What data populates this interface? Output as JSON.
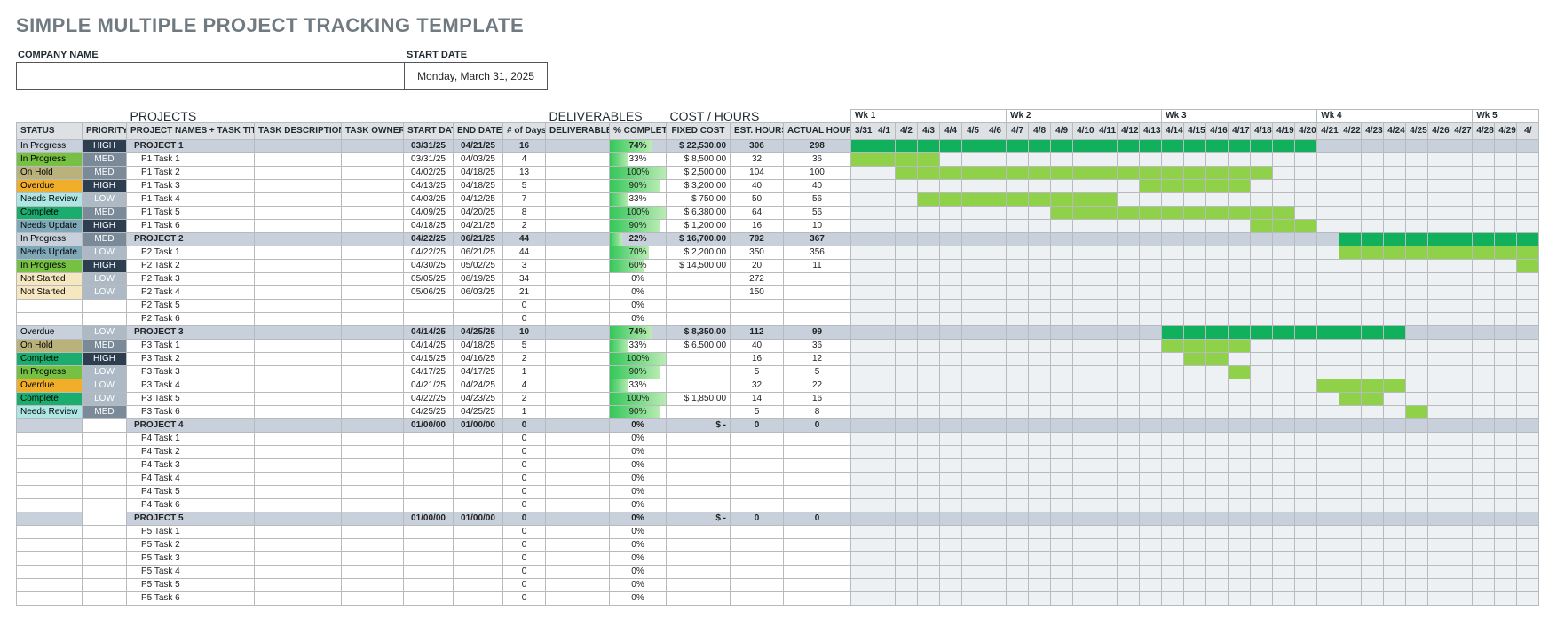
{
  "title": "SIMPLE MULTIPLE PROJECT TRACKING TEMPLATE",
  "header": {
    "company_label": "COMPANY NAME",
    "company_value": "",
    "start_date_label": "START DATE",
    "start_date_value": "Monday, March 31, 2025"
  },
  "sections": {
    "projects": "PROJECTS",
    "deliverables": "DELIVERABLES",
    "cost": "COST / HOURS"
  },
  "columns": {
    "status": "STATUS",
    "priority": "PRIORITY",
    "names": "PROJECT NAMES + TASK TITLES",
    "desc": "TASK DESCRIPTION",
    "owner": "TASK OWNER",
    "start": "START DATE",
    "end": "END DATE",
    "days": "# of Days",
    "deliverable": "DELIVERABLE",
    "pct": "% COMPLETE",
    "fixed": "FIXED COST",
    "est": "EST. HOURS",
    "actual": "ACTUAL HOURS"
  },
  "weeks": [
    "Wk 1",
    "Wk 2",
    "Wk 3",
    "Wk 4",
    "Wk 5"
  ],
  "days": [
    "3/31",
    "4/1",
    "4/2",
    "4/3",
    "4/4",
    "4/5",
    "4/6",
    "4/7",
    "4/8",
    "4/9",
    "4/10",
    "4/11",
    "4/12",
    "4/13",
    "4/14",
    "4/15",
    "4/16",
    "4/17",
    "4/18",
    "4/19",
    "4/20",
    "4/21",
    "4/22",
    "4/23",
    "4/24",
    "4/25",
    "4/26",
    "4/27",
    "4/28",
    "4/29",
    "4/"
  ],
  "rows": [
    {
      "t": "p",
      "status": "In Progress",
      "sc": "st-inprog",
      "priority": "HIGH",
      "pc": "pr-high",
      "name": "PROJECT 1",
      "start": "03/31/25",
      "end": "04/21/25",
      "days": "16",
      "pct": 74,
      "fixed": "$    22,530.00",
      "est": "306",
      "actual": "298",
      "g": [
        0,
        21,
        "dark"
      ]
    },
    {
      "t": "r",
      "status": "In Progress",
      "sc": "st-inprog",
      "priority": "MED",
      "pc": "pr-med",
      "name": "P1 Task 1",
      "start": "03/31/25",
      "end": "04/03/25",
      "days": "4",
      "pct": 33,
      "fixed": "$      8,500.00",
      "est": "32",
      "actual": "36",
      "g": [
        0,
        4,
        "light"
      ]
    },
    {
      "t": "r",
      "status": "On Hold",
      "sc": "st-onhold",
      "priority": "MED",
      "pc": "pr-med",
      "name": "P1 Task 2",
      "start": "04/02/25",
      "end": "04/18/25",
      "days": "13",
      "pct": 100,
      "fixed": "$      2,500.00",
      "est": "104",
      "actual": "100",
      "g": [
        2,
        17,
        "light"
      ]
    },
    {
      "t": "r",
      "status": "Overdue",
      "sc": "st-overdue",
      "priority": "HIGH",
      "pc": "pr-high",
      "name": "P1 Task 3",
      "start": "04/13/25",
      "end": "04/18/25",
      "days": "5",
      "pct": 90,
      "fixed": "$      3,200.00",
      "est": "40",
      "actual": "40",
      "g": [
        13,
        5,
        "light"
      ]
    },
    {
      "t": "r",
      "status": "Needs Review",
      "sc": "st-review",
      "priority": "LOW",
      "pc": "pr-low",
      "name": "P1 Task 4",
      "start": "04/03/25",
      "end": "04/12/25",
      "days": "7",
      "pct": 33,
      "fixed": "$         750.00",
      "est": "50",
      "actual": "56",
      "g": [
        3,
        9,
        "light"
      ]
    },
    {
      "t": "r",
      "status": "Complete",
      "sc": "st-complete",
      "priority": "MED",
      "pc": "pr-med",
      "name": "P1 Task 5",
      "start": "04/09/25",
      "end": "04/20/25",
      "days": "8",
      "pct": 100,
      "fixed": "$      6,380.00",
      "est": "64",
      "actual": "56",
      "g": [
        9,
        11,
        "light"
      ]
    },
    {
      "t": "r",
      "status": "Needs Update",
      "sc": "st-update",
      "priority": "HIGH",
      "pc": "pr-high",
      "name": "P1 Task 6",
      "start": "04/18/25",
      "end": "04/21/25",
      "days": "2",
      "pct": 90,
      "fixed": "$      1,200.00",
      "est": "16",
      "actual": "10",
      "g": [
        18,
        3,
        "light"
      ]
    },
    {
      "t": "p",
      "status": "In Progress",
      "sc": "st-inprog",
      "priority": "MED",
      "pc": "pr-med",
      "name": "PROJECT 2",
      "start": "04/22/25",
      "end": "06/21/25",
      "days": "44",
      "pct": 22,
      "fixed": "$    16,700.00",
      "est": "792",
      "actual": "367",
      "g": [
        22,
        9,
        "dark"
      ]
    },
    {
      "t": "r",
      "status": "Needs Update",
      "sc": "st-update",
      "priority": "LOW",
      "pc": "pr-low",
      "name": "P2 Task 1",
      "start": "04/22/25",
      "end": "06/21/25",
      "days": "44",
      "pct": 70,
      "fixed": "$      2,200.00",
      "est": "350",
      "actual": "356",
      "g": [
        22,
        9,
        "light"
      ]
    },
    {
      "t": "r",
      "status": "In Progress",
      "sc": "st-inprog",
      "priority": "HIGH",
      "pc": "pr-high",
      "name": "P2 Task 2",
      "start": "04/30/25",
      "end": "05/02/25",
      "days": "3",
      "pct": 60,
      "fixed": "$    14,500.00",
      "est": "20",
      "actual": "11",
      "g": [
        30,
        1,
        "light"
      ]
    },
    {
      "t": "r",
      "status": "Not Started",
      "sc": "st-notstart",
      "priority": "LOW",
      "pc": "pr-low",
      "name": "P2 Task 3",
      "start": "05/05/25",
      "end": "06/19/25",
      "days": "34",
      "pct": 0,
      "fixed": "",
      "est": "272",
      "actual": ""
    },
    {
      "t": "r",
      "status": "Not Started",
      "sc": "st-notstart",
      "priority": "LOW",
      "pc": "pr-low",
      "name": "P2 Task 4",
      "start": "05/06/25",
      "end": "06/03/25",
      "days": "21",
      "pct": 0,
      "fixed": "",
      "est": "150",
      "actual": ""
    },
    {
      "t": "r",
      "status": "",
      "sc": "",
      "priority": "",
      "pc": "",
      "name": "P2 Task 5",
      "start": "",
      "end": "",
      "days": "0",
      "pct": 0,
      "fixed": "",
      "est": "",
      "actual": ""
    },
    {
      "t": "r",
      "status": "",
      "sc": "",
      "priority": "",
      "pc": "",
      "name": "P2 Task 6",
      "start": "",
      "end": "",
      "days": "0",
      "pct": 0,
      "fixed": "",
      "est": "",
      "actual": ""
    },
    {
      "t": "p",
      "status": "Overdue",
      "sc": "st-overdue",
      "priority": "LOW",
      "pc": "pr-low",
      "name": "PROJECT 3",
      "start": "04/14/25",
      "end": "04/25/25",
      "days": "10",
      "pct": 74,
      "fixed": "$      8,350.00",
      "est": "112",
      "actual": "99",
      "g": [
        14,
        11,
        "dark"
      ]
    },
    {
      "t": "r",
      "status": "On Hold",
      "sc": "st-onhold",
      "priority": "MED",
      "pc": "pr-med",
      "name": "P3 Task 1",
      "start": "04/14/25",
      "end": "04/18/25",
      "days": "5",
      "pct": 33,
      "fixed": "$      6,500.00",
      "est": "40",
      "actual": "36",
      "g": [
        14,
        4,
        "light"
      ]
    },
    {
      "t": "r",
      "status": "Complete",
      "sc": "st-complete",
      "priority": "HIGH",
      "pc": "pr-high",
      "name": "P3 Task 2",
      "start": "04/15/25",
      "end": "04/16/25",
      "days": "2",
      "pct": 100,
      "fixed": "",
      "est": "16",
      "actual": "12",
      "g": [
        15,
        2,
        "light"
      ]
    },
    {
      "t": "r",
      "status": "In Progress",
      "sc": "st-inprog",
      "priority": "LOW",
      "pc": "pr-low",
      "name": "P3 Task 3",
      "start": "04/17/25",
      "end": "04/17/25",
      "days": "1",
      "pct": 90,
      "fixed": "",
      "est": "5",
      "actual": "5",
      "g": [
        17,
        1,
        "light"
      ]
    },
    {
      "t": "r",
      "status": "Overdue",
      "sc": "st-overdue",
      "priority": "LOW",
      "pc": "pr-low",
      "name": "P3 Task 4",
      "start": "04/21/25",
      "end": "04/24/25",
      "days": "4",
      "pct": 33,
      "fixed": "",
      "est": "32",
      "actual": "22",
      "g": [
        21,
        4,
        "light"
      ]
    },
    {
      "t": "r",
      "status": "Complete",
      "sc": "st-complete",
      "priority": "LOW",
      "pc": "pr-low",
      "name": "P3 Task 5",
      "start": "04/22/25",
      "end": "04/23/25",
      "days": "2",
      "pct": 100,
      "fixed": "$      1,850.00",
      "est": "14",
      "actual": "16",
      "g": [
        22,
        2,
        "light"
      ]
    },
    {
      "t": "r",
      "status": "Needs Review",
      "sc": "st-review",
      "priority": "MED",
      "pc": "pr-med",
      "name": "P3 Task 6",
      "start": "04/25/25",
      "end": "04/25/25",
      "days": "1",
      "pct": 90,
      "fixed": "",
      "est": "5",
      "actual": "8",
      "g": [
        25,
        1,
        "light"
      ]
    },
    {
      "t": "p",
      "status": "",
      "sc": "",
      "priority": "",
      "pc": "",
      "name": "PROJECT 4",
      "start": "01/00/00",
      "end": "01/00/00",
      "days": "0",
      "pct": 0,
      "fixed": "$            -",
      "est": "0",
      "actual": "0"
    },
    {
      "t": "r",
      "status": "",
      "sc": "",
      "priority": "",
      "pc": "",
      "name": "P4 Task 1",
      "start": "",
      "end": "",
      "days": "0",
      "pct": 0,
      "fixed": "",
      "est": "",
      "actual": ""
    },
    {
      "t": "r",
      "status": "",
      "sc": "",
      "priority": "",
      "pc": "",
      "name": "P4 Task 2",
      "start": "",
      "end": "",
      "days": "0",
      "pct": 0,
      "fixed": "",
      "est": "",
      "actual": ""
    },
    {
      "t": "r",
      "status": "",
      "sc": "",
      "priority": "",
      "pc": "",
      "name": "P4 Task 3",
      "start": "",
      "end": "",
      "days": "0",
      "pct": 0,
      "fixed": "",
      "est": "",
      "actual": ""
    },
    {
      "t": "r",
      "status": "",
      "sc": "",
      "priority": "",
      "pc": "",
      "name": "P4 Task 4",
      "start": "",
      "end": "",
      "days": "0",
      "pct": 0,
      "fixed": "",
      "est": "",
      "actual": ""
    },
    {
      "t": "r",
      "status": "",
      "sc": "",
      "priority": "",
      "pc": "",
      "name": "P4 Task 5",
      "start": "",
      "end": "",
      "days": "0",
      "pct": 0,
      "fixed": "",
      "est": "",
      "actual": ""
    },
    {
      "t": "r",
      "status": "",
      "sc": "",
      "priority": "",
      "pc": "",
      "name": "P4 Task 6",
      "start": "",
      "end": "",
      "days": "0",
      "pct": 0,
      "fixed": "",
      "est": "",
      "actual": ""
    },
    {
      "t": "p",
      "status": "",
      "sc": "",
      "priority": "",
      "pc": "",
      "name": "PROJECT 5",
      "start": "01/00/00",
      "end": "01/00/00",
      "days": "0",
      "pct": 0,
      "fixed": "$            -",
      "est": "0",
      "actual": "0"
    },
    {
      "t": "r",
      "status": "",
      "sc": "",
      "priority": "",
      "pc": "",
      "name": "P5 Task 1",
      "start": "",
      "end": "",
      "days": "0",
      "pct": 0,
      "fixed": "",
      "est": "",
      "actual": ""
    },
    {
      "t": "r",
      "status": "",
      "sc": "",
      "priority": "",
      "pc": "",
      "name": "P5 Task 2",
      "start": "",
      "end": "",
      "days": "0",
      "pct": 0,
      "fixed": "",
      "est": "",
      "actual": ""
    },
    {
      "t": "r",
      "status": "",
      "sc": "",
      "priority": "",
      "pc": "",
      "name": "P5 Task 3",
      "start": "",
      "end": "",
      "days": "0",
      "pct": 0,
      "fixed": "",
      "est": "",
      "actual": ""
    },
    {
      "t": "r",
      "status": "",
      "sc": "",
      "priority": "",
      "pc": "",
      "name": "P5 Task 4",
      "start": "",
      "end": "",
      "days": "0",
      "pct": 0,
      "fixed": "",
      "est": "",
      "actual": ""
    },
    {
      "t": "r",
      "status": "",
      "sc": "",
      "priority": "",
      "pc": "",
      "name": "P5 Task 5",
      "start": "",
      "end": "",
      "days": "0",
      "pct": 0,
      "fixed": "",
      "est": "",
      "actual": ""
    },
    {
      "t": "r",
      "status": "",
      "sc": "",
      "priority": "",
      "pc": "",
      "name": "P5 Task 6",
      "start": "",
      "end": "",
      "days": "0",
      "pct": 0,
      "fixed": "",
      "est": "",
      "actual": ""
    }
  ]
}
